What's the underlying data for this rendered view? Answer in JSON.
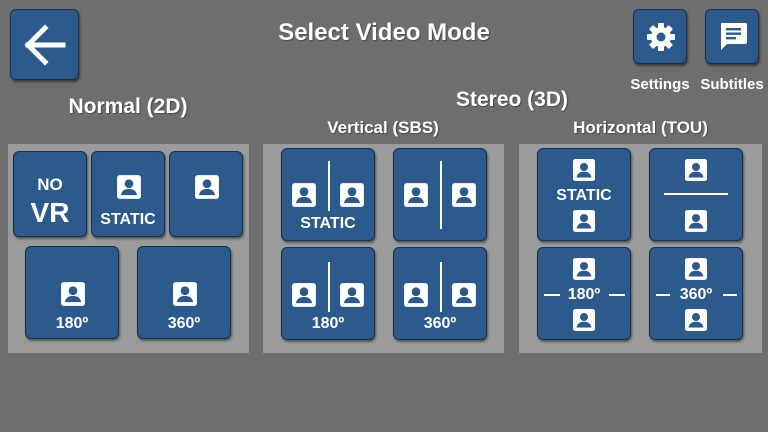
{
  "header": {
    "title": "Select Video Mode",
    "back_icon": "arrow-left-icon",
    "settings_label": "Settings",
    "settings_icon": "gear-icon",
    "subtitles_label": "Subtitles",
    "subtitles_icon": "subtitles-icon"
  },
  "sections": {
    "normal_title": "Normal (2D)",
    "stereo_title": "Stereo (3D)",
    "sbs_title": "Vertical (SBS)",
    "tou_title": "Horizontal (TOU)"
  },
  "normal": {
    "no_vr_top": "NO",
    "no_vr_bottom": "VR",
    "static": "STATIC",
    "deg180": "180º",
    "deg360": "360º"
  },
  "sbs": {
    "static": "STATIC",
    "deg180": "180º",
    "deg360": "360º"
  },
  "tou": {
    "static": "STATIC",
    "deg180": "180º",
    "deg360": "360º"
  },
  "colors": {
    "button": "#2c5a8c",
    "panel": "#9b9b9b",
    "background": "#6e6e6e"
  }
}
